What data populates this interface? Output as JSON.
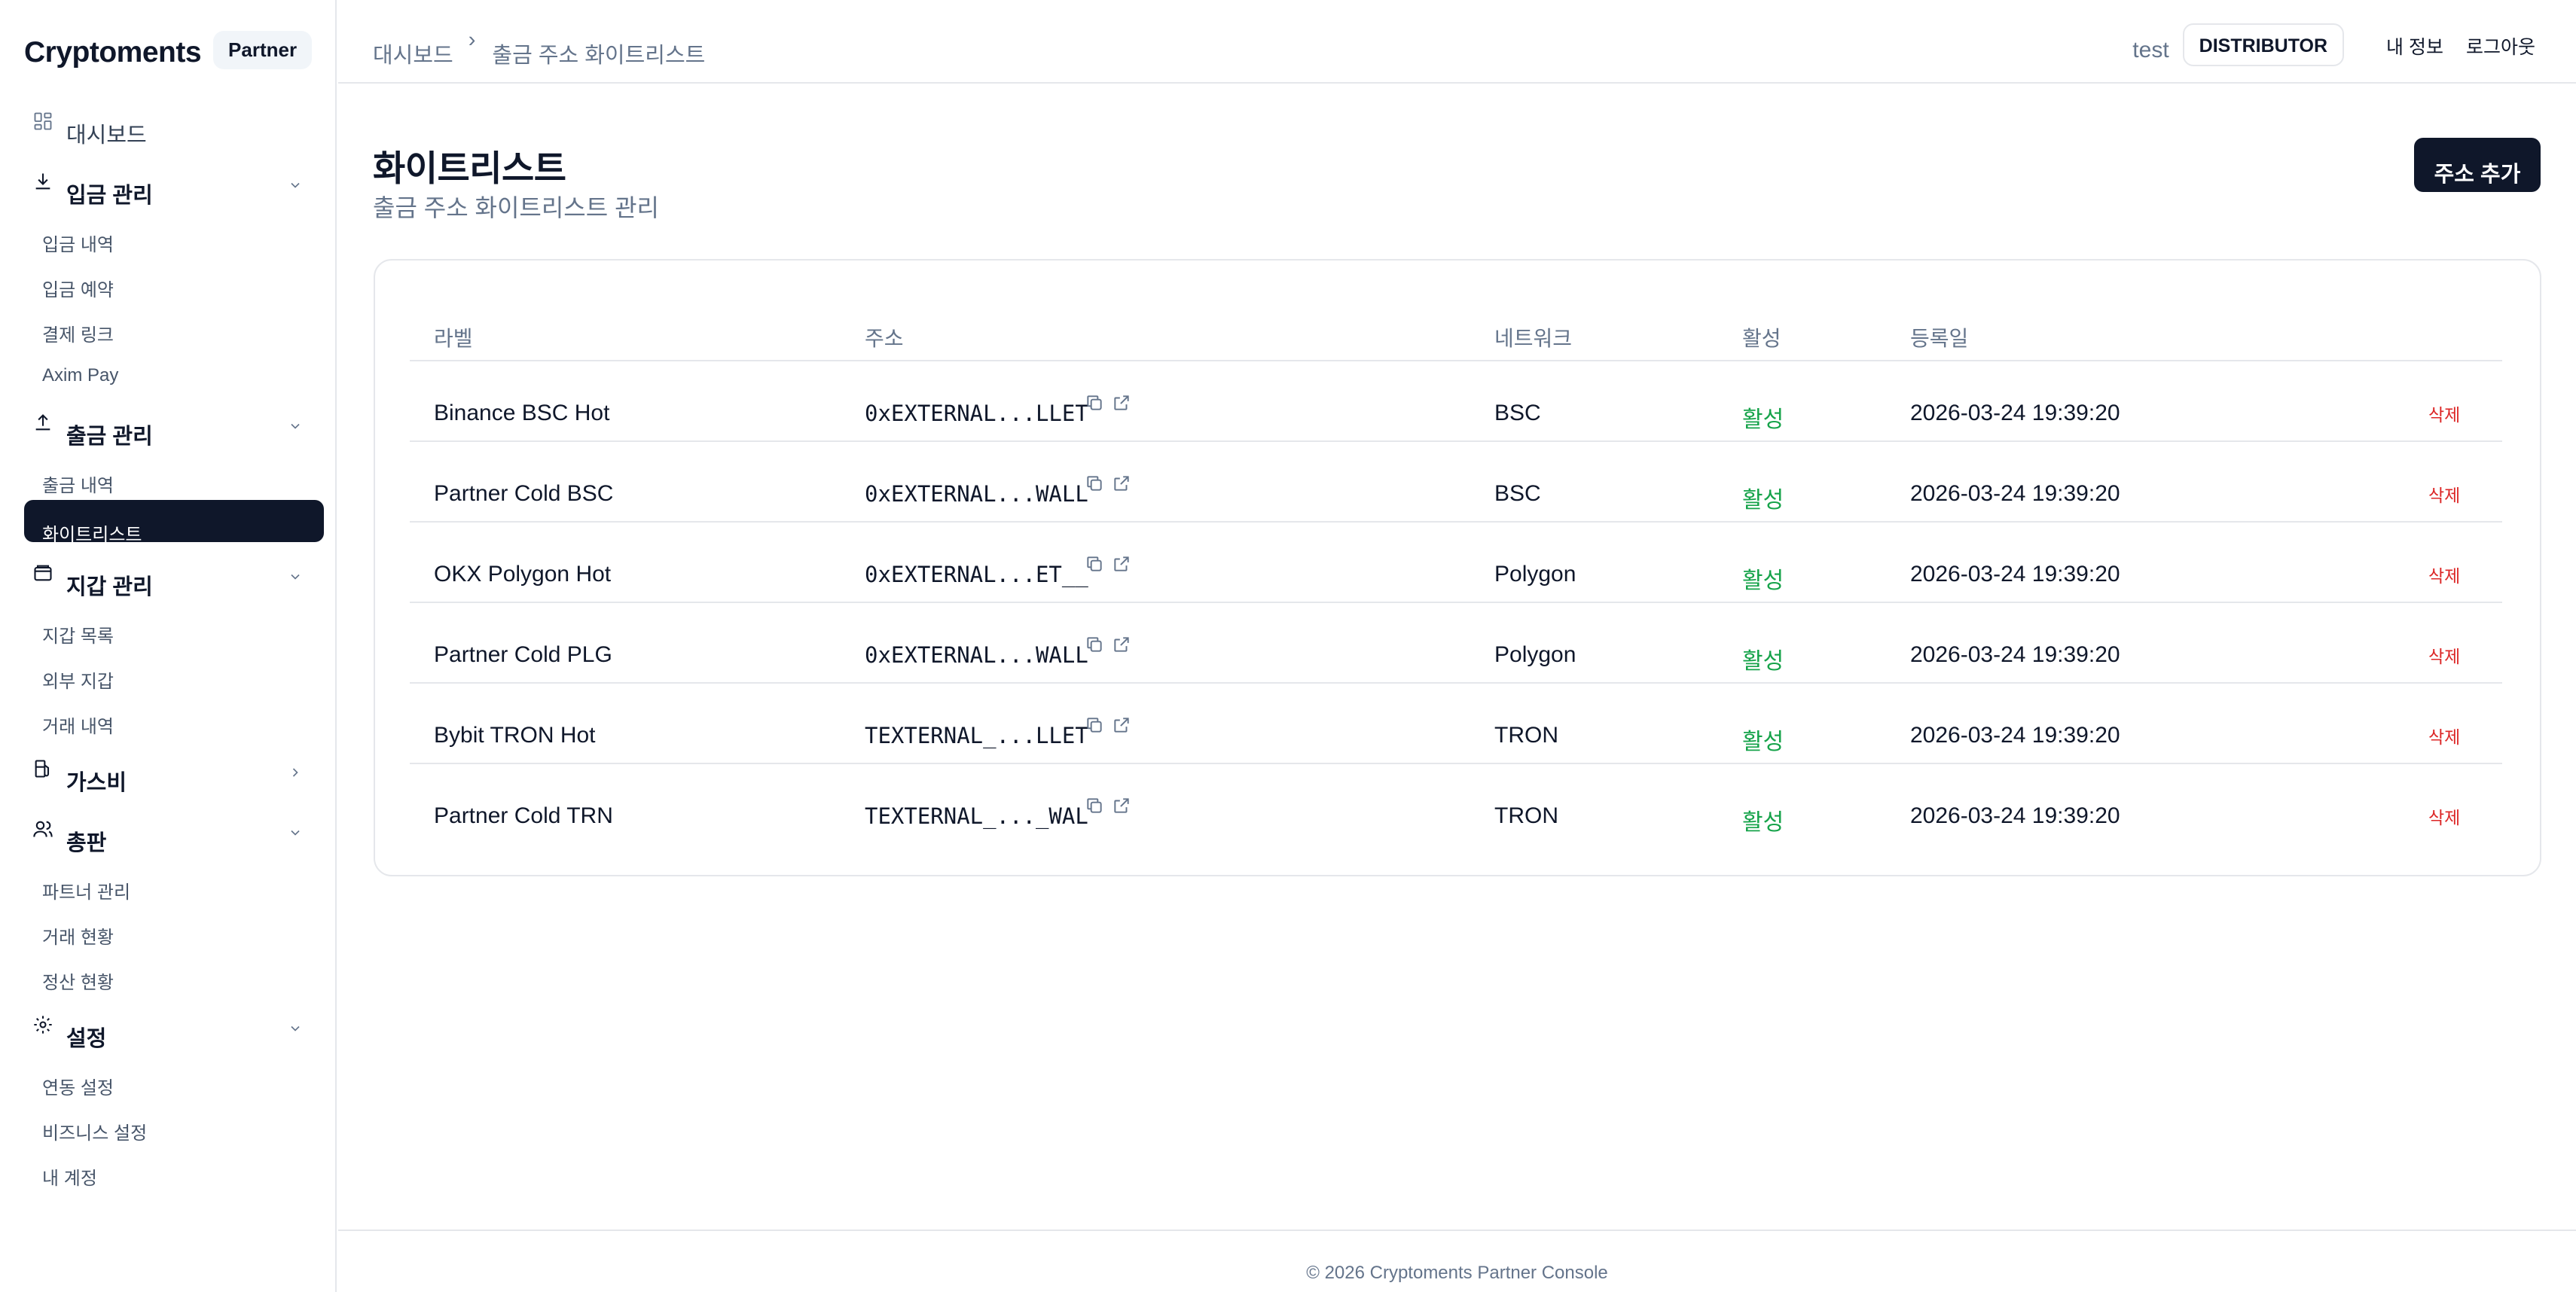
{
  "brand": {
    "name": "Cryptoments",
    "badge": "Partner"
  },
  "sidebar": {
    "dashboard": "대시보드",
    "groups": [
      {
        "label": "입금 관리",
        "items": [
          "입금 내역",
          "입금 예약",
          "결제 링크",
          "Axim Pay"
        ]
      },
      {
        "label": "출금 관리",
        "items": [
          "출금 내역",
          "화이트리스트"
        ]
      },
      {
        "label": "지갑 관리",
        "items": [
          "지갑 목록",
          "외부 지갑",
          "거래 내역"
        ]
      },
      {
        "label": "가스비",
        "items": []
      },
      {
        "label": "총판",
        "items": [
          "파트너 관리",
          "거래 현황",
          "정산 현황"
        ]
      },
      {
        "label": "설정",
        "items": [
          "연동 설정",
          "비즈니스 설정",
          "내 계정"
        ]
      }
    ]
  },
  "header": {
    "breadcrumb": [
      "대시보드",
      "출금 주소 화이트리스트"
    ],
    "breadcrumb_sep": "›",
    "username": "test",
    "role": "DISTRIBUTOR",
    "my_info": "내 정보",
    "logout": "로그아웃"
  },
  "page": {
    "title": "화이트리스트",
    "subtitle": "출금 주소 화이트리스트 관리",
    "add_button": "주소 추가"
  },
  "table": {
    "columns": [
      "라벨",
      "주소",
      "네트워크",
      "활성",
      "등록일"
    ],
    "delete_label": "삭제",
    "rows": [
      {
        "label": "Binance BSC Hot",
        "address": "0xEXTERNAL...LLET",
        "network": "BSC",
        "active": "활성",
        "registered": "2026-03-24 19:39:20"
      },
      {
        "label": "Partner Cold BSC",
        "address": "0xEXTERNAL...WALL",
        "network": "BSC",
        "active": "활성",
        "registered": "2026-03-24 19:39:20"
      },
      {
        "label": "OKX Polygon Hot",
        "address": "0xEXTERNAL...ET__",
        "network": "Polygon",
        "active": "활성",
        "registered": "2026-03-24 19:39:20"
      },
      {
        "label": "Partner Cold PLG",
        "address": "0xEXTERNAL...WALL",
        "network": "Polygon",
        "active": "활성",
        "registered": "2026-03-24 19:39:20"
      },
      {
        "label": "Bybit TRON Hot",
        "address": "TEXTERNAL_...LLET",
        "network": "TRON",
        "active": "활성",
        "registered": "2026-03-24 19:39:20"
      },
      {
        "label": "Partner Cold TRN",
        "address": "TEXTERNAL_..._WAL",
        "network": "TRON",
        "active": "활성",
        "registered": "2026-03-24 19:39:20"
      }
    ]
  },
  "footer": {
    "text": "© 2026 Cryptoments Partner Console"
  },
  "colors": {
    "primary": "#0f172a",
    "active_green": "#16a34a",
    "danger": "#dc2626",
    "muted": "#64748b",
    "border": "#e5e7eb"
  }
}
